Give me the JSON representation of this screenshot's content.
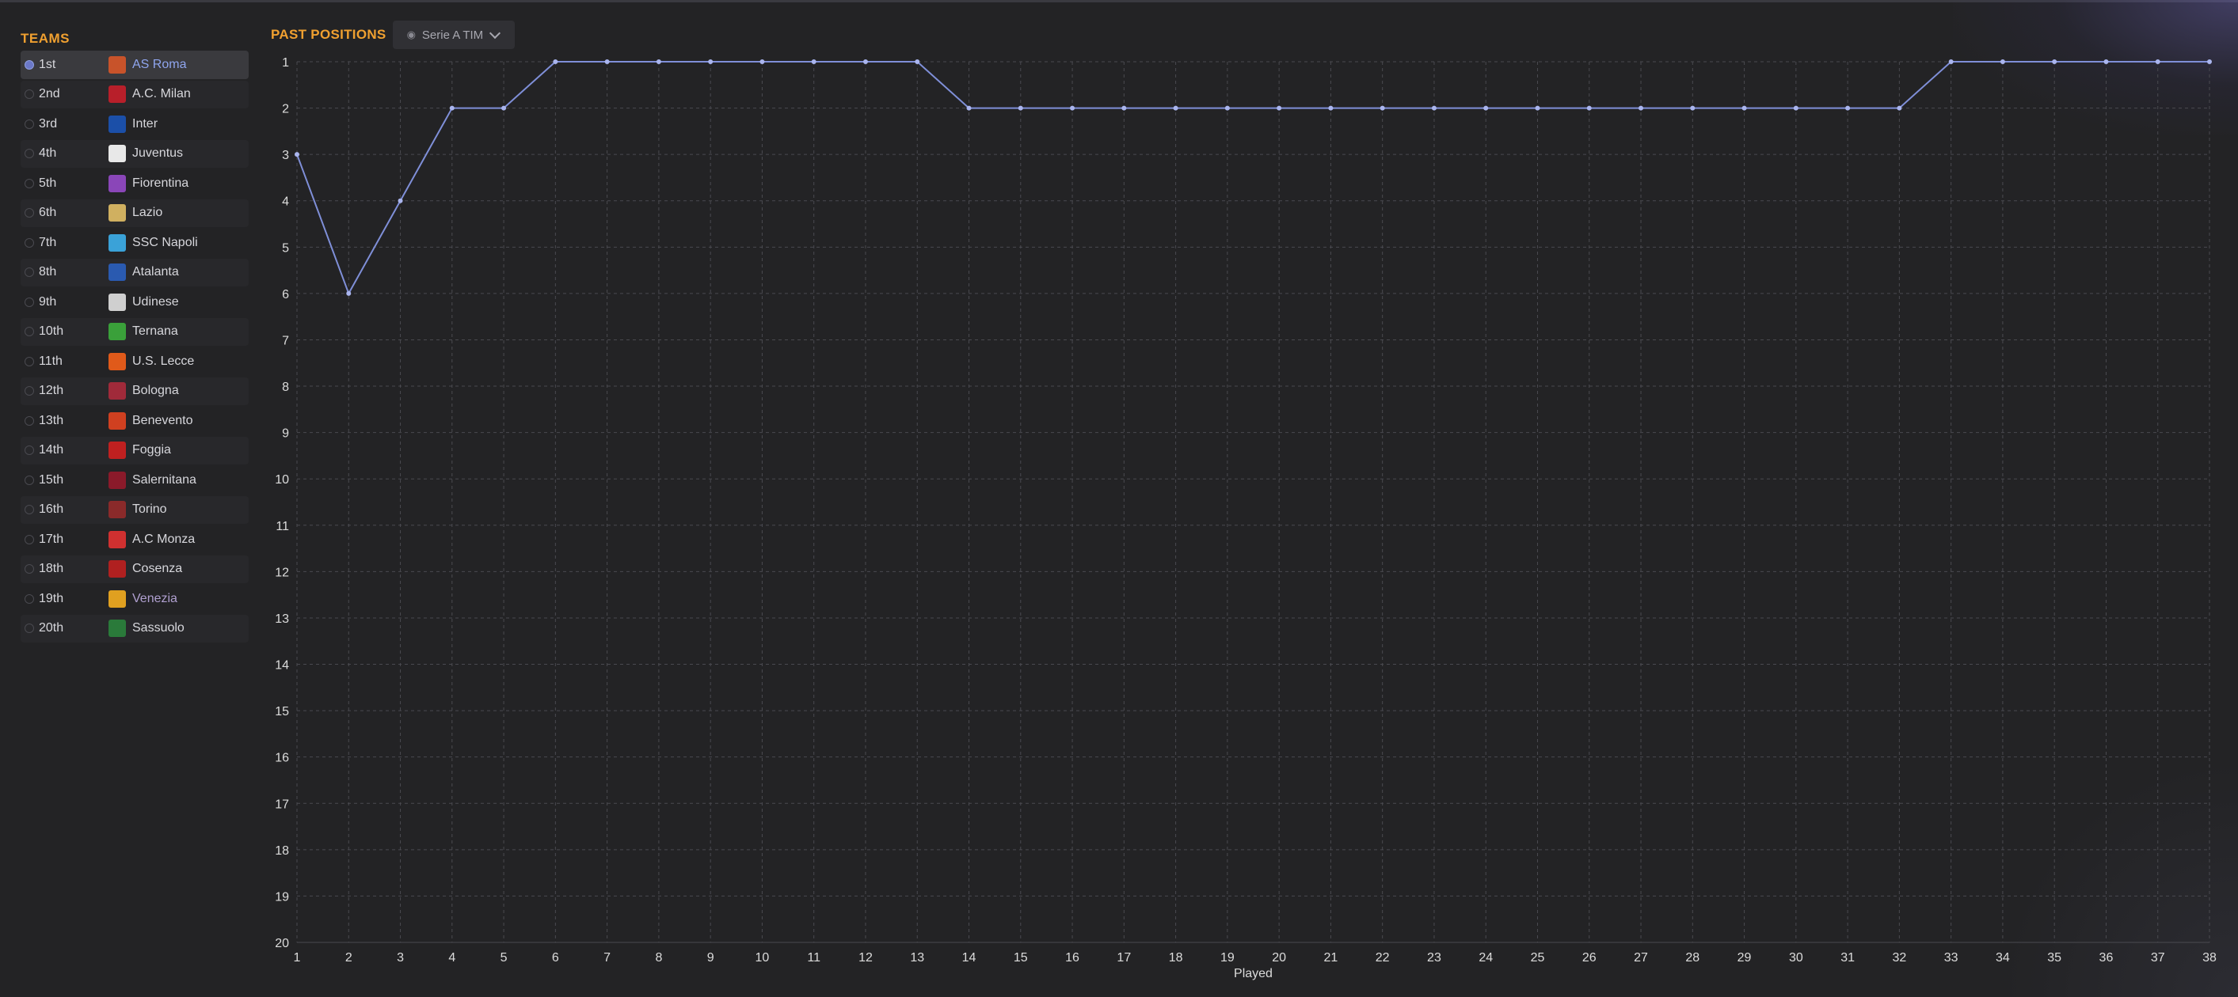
{
  "sidebar": {
    "title": "TEAMS",
    "teams": [
      {
        "pos": "1st",
        "name": "AS Roma",
        "crest_color": "#c8532a",
        "selected": true
      },
      {
        "pos": "2nd",
        "name": "A.C. Milan",
        "crest_color": "#b81f2a"
      },
      {
        "pos": "3rd",
        "name": "Inter",
        "crest_color": "#1b4fa8"
      },
      {
        "pos": "4th",
        "name": "Juventus",
        "crest_color": "#e8e8e8"
      },
      {
        "pos": "5th",
        "name": "Fiorentina",
        "crest_color": "#8a46b8"
      },
      {
        "pos": "6th",
        "name": "Lazio",
        "crest_color": "#d0b060"
      },
      {
        "pos": "7th",
        "name": "SSC Napoli",
        "crest_color": "#3aa2d8"
      },
      {
        "pos": "8th",
        "name": "Atalanta",
        "crest_color": "#2a5ab0"
      },
      {
        "pos": "9th",
        "name": "Udinese",
        "crest_color": "#cfcfcf"
      },
      {
        "pos": "10th",
        "name": "Ternana",
        "crest_color": "#3aa03a"
      },
      {
        "pos": "11th",
        "name": "U.S. Lecce",
        "crest_color": "#e05a1a"
      },
      {
        "pos": "12th",
        "name": "Bologna",
        "crest_color": "#a02a3a"
      },
      {
        "pos": "13th",
        "name": "Benevento",
        "crest_color": "#d04020"
      },
      {
        "pos": "14th",
        "name": "Foggia",
        "crest_color": "#c02020"
      },
      {
        "pos": "15th",
        "name": "Salernitana",
        "crest_color": "#8a1a2a"
      },
      {
        "pos": "16th",
        "name": "Torino",
        "crest_color": "#8a2a2a"
      },
      {
        "pos": "17th",
        "name": "A.C Monza",
        "crest_color": "#d03030"
      },
      {
        "pos": "18th",
        "name": "Cosenza",
        "crest_color": "#b02020"
      },
      {
        "pos": "19th",
        "name": "Venezia",
        "crest_color": "#e0a020"
      },
      {
        "pos": "20th",
        "name": "Sassuolo",
        "crest_color": "#2a7a3a"
      }
    ]
  },
  "header": {
    "title": "PAST POSITIONS",
    "competition": "Serie A TIM"
  },
  "chart_data": {
    "type": "line",
    "xlabel": "Played",
    "ylabel": "",
    "x": [
      1,
      2,
      3,
      4,
      5,
      6,
      7,
      8,
      9,
      10,
      11,
      12,
      13,
      14,
      15,
      16,
      17,
      18,
      19,
      20,
      21,
      22,
      23,
      24,
      25,
      26,
      27,
      28,
      29,
      30,
      31,
      32,
      33,
      34,
      35,
      36,
      37,
      38
    ],
    "xlim": [
      1,
      38
    ],
    "ylim": [
      1,
      20
    ],
    "y_inverted": true,
    "grid": true,
    "series": [
      {
        "name": "AS Roma",
        "color": "#7f8fd8",
        "values": [
          3,
          6,
          4,
          2,
          2,
          1,
          1,
          1,
          1,
          1,
          1,
          1,
          1,
          2,
          2,
          2,
          2,
          2,
          2,
          2,
          2,
          2,
          2,
          2,
          2,
          2,
          2,
          2,
          2,
          2,
          2,
          2,
          1,
          1,
          1,
          1,
          1,
          1
        ]
      }
    ]
  }
}
